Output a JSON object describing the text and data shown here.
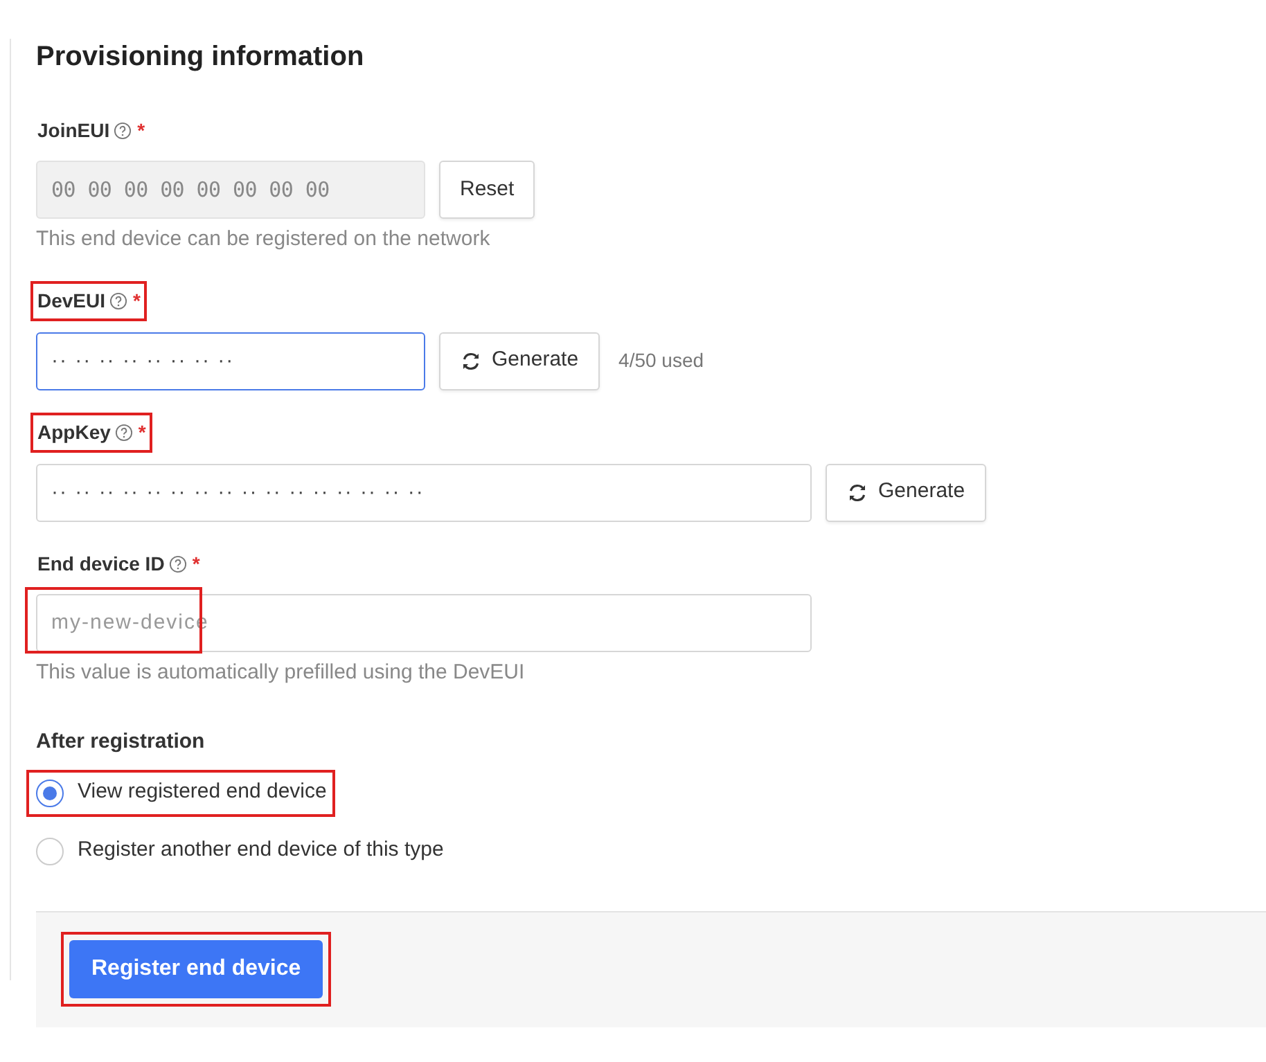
{
  "title": "Provisioning information",
  "fields": [
    {
      "label": "JoinEUI",
      "required": "*",
      "highlighted": false,
      "kind": "short",
      "input": {
        "value": "00 00 00 00 00 00 00 00",
        "readonly": true,
        "focused": false
      },
      "button": {
        "label": "Reset"
      },
      "hint": "This end device can be registered on the network"
    },
    {
      "label": "DevEUI",
      "required": "*",
      "highlighted": true,
      "kind": "short",
      "input": {
        "value": "·· ·· ·· ·· ·· ·· ·· ··",
        "readonly": false,
        "focused": true
      },
      "button": {
        "label": "Generate",
        "icon": true
      },
      "note": "4/50 used"
    },
    {
      "label": "AppKey",
      "required": "*",
      "highlighted": true,
      "kind": "long",
      "input": {
        "value": "·· ·· ·· ·· ·· ·· ·· ·· ·· ·· ·· ·· ·· ·· ·· ··",
        "readonly": false,
        "focused": false
      },
      "button": {
        "label": "Generate",
        "icon": true
      }
    },
    {
      "label": "End device ID",
      "required": "*",
      "highlighted": false,
      "kind": "long",
      "input": {
        "placeholder": "my-new-device",
        "readonly": false,
        "focused": false,
        "highlighted": true
      },
      "hint": "This value is automatically prefilled using the DevEUI"
    }
  ],
  "after_registration": {
    "label": "After registration",
    "options": [
      {
        "label": "View registered end device",
        "selected": true,
        "highlighted": true
      },
      {
        "label": "Register another end device of this type",
        "selected": false,
        "highlighted": false
      }
    ]
  },
  "submit": {
    "label": "Register end device",
    "highlighted": true
  }
}
